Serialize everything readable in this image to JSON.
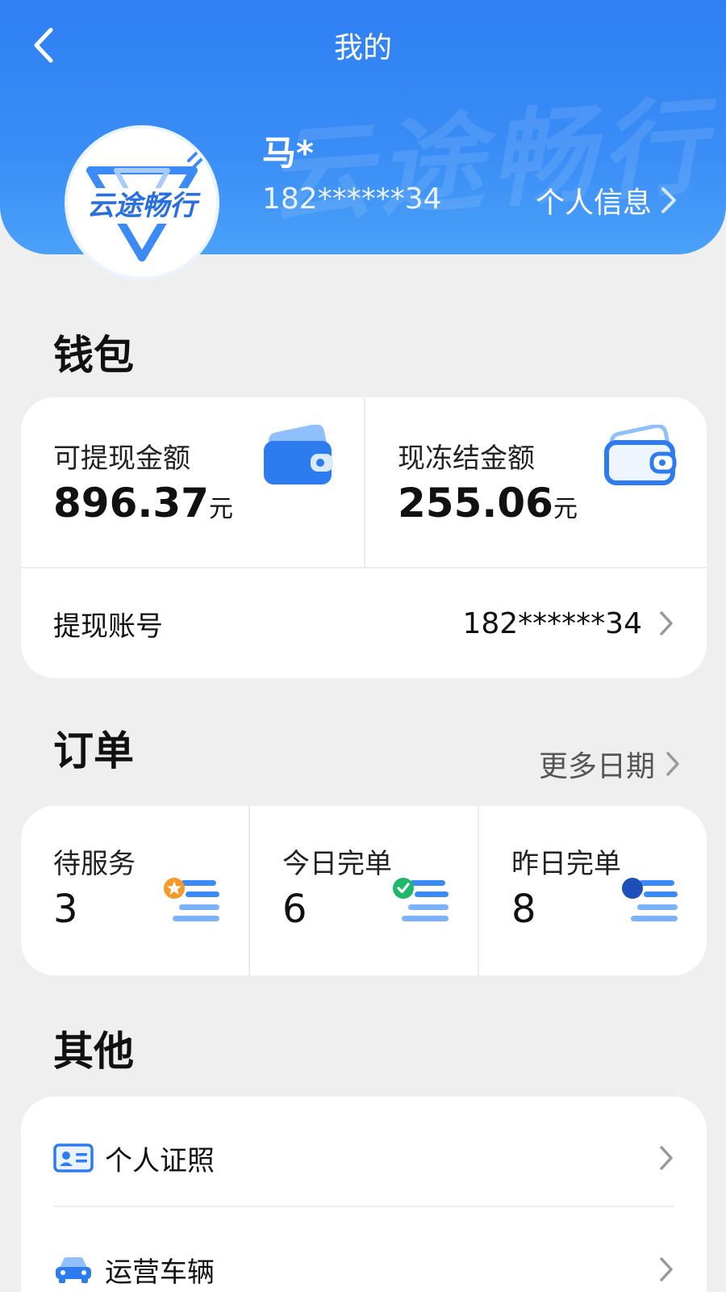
{
  "header": {
    "title": "我的",
    "watermark": "云途畅行",
    "avatar_logo": "云途畅行",
    "user_name": "马*",
    "phone": "182******34",
    "profile_link": "个人信息"
  },
  "wallet": {
    "section_title": "钱包",
    "withdrawable": {
      "label": "可提现金额",
      "amount": "896.37",
      "unit": "元",
      "icon": "wallet-icon"
    },
    "frozen": {
      "label": "现冻结金额",
      "amount": "255.06",
      "unit": "元",
      "icon": "wallet-outline-icon"
    },
    "account": {
      "label": "提现账号",
      "value": "182******34"
    }
  },
  "orders": {
    "section_title": "订单",
    "more_link": "更多日期",
    "items": [
      {
        "label": "待服务",
        "count": "3",
        "icon": "pending-list-icon"
      },
      {
        "label": "今日完单",
        "count": "6",
        "icon": "check-list-icon"
      },
      {
        "label": "昨日完单",
        "count": "8",
        "icon": "dot-list-icon"
      }
    ]
  },
  "other": {
    "section_title": "其他",
    "items": [
      {
        "label": "个人证照",
        "icon": "id-card-icon"
      },
      {
        "label": "运营车辆",
        "icon": "car-icon"
      }
    ]
  },
  "colors": {
    "primary": "#2f7ff3",
    "orange": "#f39a2a",
    "green": "#1fb86a",
    "navy": "#1d4fb8"
  }
}
